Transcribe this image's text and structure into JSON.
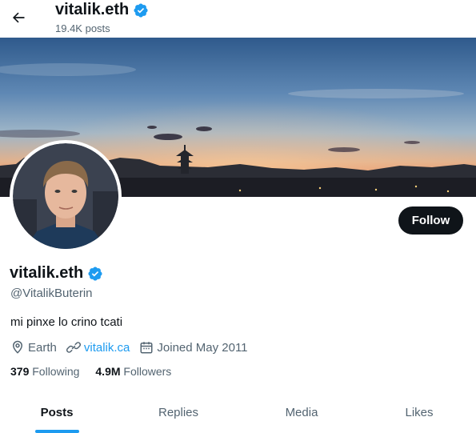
{
  "header": {
    "title": "vitalik.eth",
    "post_count": "19.4K posts"
  },
  "profile": {
    "display_name": "vitalik.eth",
    "handle": "@VitalikButerin",
    "bio": "mi pinxe lo crino tcati",
    "location": "Earth",
    "website": "vitalik.ca",
    "joined": "Joined May 2011",
    "verified": true
  },
  "stats": {
    "following_count": "379",
    "following_label": "Following",
    "followers_count": "4.9M",
    "followers_label": "Followers"
  },
  "actions": {
    "follow_label": "Follow"
  },
  "tabs": [
    {
      "label": "Posts",
      "active": true
    },
    {
      "label": "Replies",
      "active": false
    },
    {
      "label": "Media",
      "active": false
    },
    {
      "label": "Likes",
      "active": false
    }
  ],
  "icons": {
    "back": "arrow-left-icon",
    "verified": "verified-badge-icon",
    "location": "location-pin-icon",
    "link": "link-icon",
    "calendar": "calendar-icon"
  },
  "colors": {
    "accent": "#1d9bf0",
    "text_primary": "#0f1419",
    "text_secondary": "#536471",
    "follow_button": "#0f1419"
  }
}
